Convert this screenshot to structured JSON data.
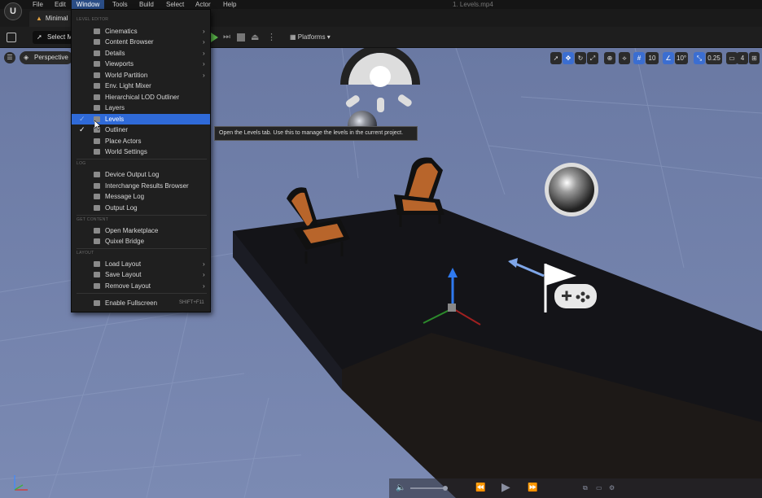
{
  "menubar": {
    "items": [
      "File",
      "Edit",
      "Window",
      "Tools",
      "Build",
      "Select",
      "Actor",
      "Help"
    ],
    "active": "Window",
    "file_title": "1. Levels.mp4"
  },
  "tab": {
    "label": "Minimal"
  },
  "toolbar": {
    "select_label": "Select M",
    "platforms_label": "Platforms"
  },
  "viewport": {
    "perspective_label": "Perspective",
    "grid_snap": "10",
    "rotation_snap": "10°",
    "scale_snap": "0.25",
    "camera_speed": "4"
  },
  "window_menu": {
    "sections": [
      {
        "header": "LEVEL EDITOR",
        "items": [
          {
            "label": "Cinematics",
            "submenu": true
          },
          {
            "label": "Content Browser",
            "submenu": true
          },
          {
            "label": "Details",
            "submenu": true
          },
          {
            "label": "Viewports",
            "submenu": true
          },
          {
            "label": "World Partition",
            "submenu": true
          },
          {
            "label": "Env. Light Mixer"
          },
          {
            "label": "Hierarchical LOD Outliner"
          },
          {
            "label": "Layers"
          },
          {
            "label": "Levels",
            "highlighted": true,
            "checked": true
          },
          {
            "label": "Outliner",
            "checked": true
          },
          {
            "label": "Place Actors"
          },
          {
            "label": "World Settings"
          }
        ]
      },
      {
        "header": "LOG",
        "items": [
          {
            "label": "Device Output Log"
          },
          {
            "label": "Interchange Results Browser"
          },
          {
            "label": "Message Log"
          },
          {
            "label": "Output Log"
          }
        ]
      },
      {
        "header": "GET CONTENT",
        "items": [
          {
            "label": "Open Marketplace"
          },
          {
            "label": "Quixel Bridge"
          }
        ]
      },
      {
        "header": "LAYOUT",
        "items": [
          {
            "label": "Load Layout",
            "submenu": true
          },
          {
            "label": "Save Layout",
            "submenu": true
          },
          {
            "label": "Remove Layout",
            "submenu": true
          }
        ]
      },
      {
        "header": "",
        "items": [
          {
            "label": "Enable Fullscreen",
            "shortcut": "SHIFT+F11"
          }
        ]
      }
    ]
  },
  "tooltip": "Open the Levels tab. Use this to manage the levels in the current project.",
  "colors": {
    "accent": "#2f6ad8",
    "viewport_sky": "#6f7fa8",
    "menu_bg": "#1f1f1f",
    "play_green": "#5ab54a",
    "chair_orange": "#b8652b"
  }
}
